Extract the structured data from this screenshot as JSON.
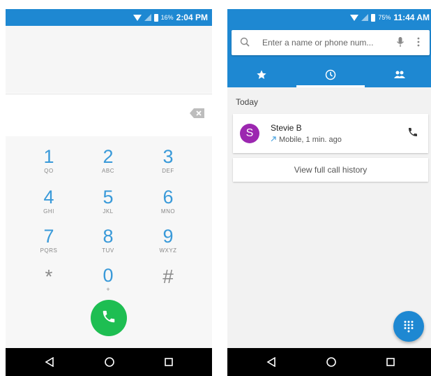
{
  "colors": {
    "accent": "#1e88d2",
    "call_green": "#1ebe52",
    "avatar_purple": "#9c27b0"
  },
  "dialer": {
    "status": {
      "battery": "16%",
      "time": "2:04 PM"
    },
    "keys": [
      {
        "digit": "1",
        "letters": "QO"
      },
      {
        "digit": "2",
        "letters": "ABC"
      },
      {
        "digit": "3",
        "letters": "DEF"
      },
      {
        "digit": "4",
        "letters": "GHI"
      },
      {
        "digit": "5",
        "letters": "JKL"
      },
      {
        "digit": "6",
        "letters": "MNO"
      },
      {
        "digit": "7",
        "letters": "PQRS"
      },
      {
        "digit": "8",
        "letters": "TUV"
      },
      {
        "digit": "9",
        "letters": "WXYZ"
      }
    ],
    "star": "*",
    "zero": "0",
    "zero_sub": "+",
    "hash": "#",
    "icons": {
      "backspace": "backspace-icon",
      "call": "phone-icon"
    }
  },
  "calllog": {
    "status": {
      "battery": "75%",
      "time": "11:44 AM"
    },
    "search": {
      "placeholder": "Enter a name or phone num..."
    },
    "tabs": [
      "speed-dial",
      "recents",
      "contacts"
    ],
    "section": "Today",
    "entry": {
      "initial": "S",
      "name": "Stevie B",
      "detail": "Mobile, 1 min. ago"
    },
    "history_label": "View full call history"
  },
  "navbar": {
    "buttons": [
      "back",
      "home",
      "recents"
    ]
  }
}
